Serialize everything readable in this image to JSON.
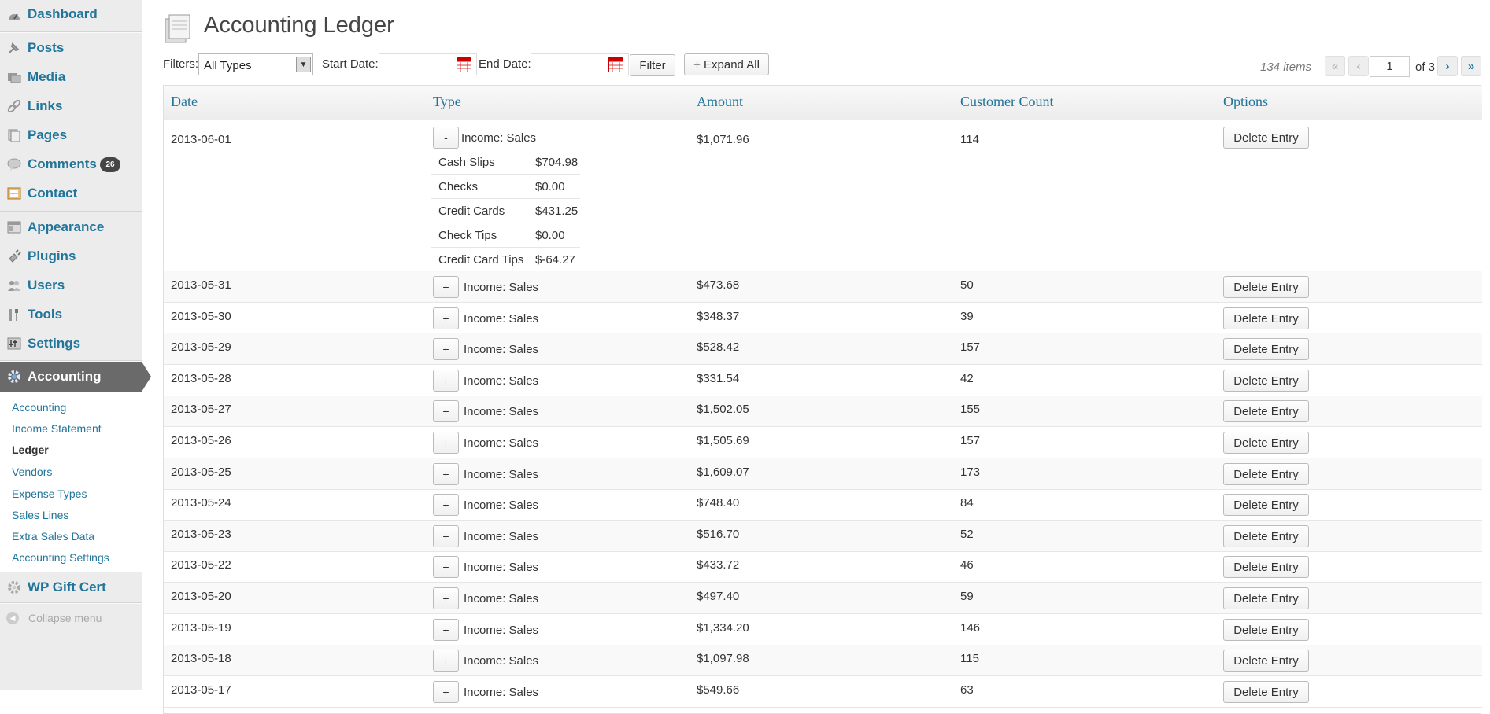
{
  "sidebar": {
    "items": [
      {
        "label": "Dashboard",
        "icon": "dashboard-icon"
      },
      {
        "label": "Posts",
        "icon": "pin-icon"
      },
      {
        "label": "Media",
        "icon": "media-icon"
      },
      {
        "label": "Links",
        "icon": "links-icon"
      },
      {
        "label": "Pages",
        "icon": "pages-icon"
      },
      {
        "label": "Comments",
        "icon": "comments-icon",
        "badge": "26"
      },
      {
        "label": "Contact",
        "icon": "contact-icon"
      },
      {
        "label": "Appearance",
        "icon": "appearance-icon"
      },
      {
        "label": "Plugins",
        "icon": "plugins-icon"
      },
      {
        "label": "Users",
        "icon": "users-icon"
      },
      {
        "label": "Tools",
        "icon": "tools-icon"
      },
      {
        "label": "Settings",
        "icon": "settings-icon"
      }
    ],
    "active": {
      "label": "Accounting",
      "icon": "gear-icon"
    },
    "submenu": [
      "Accounting",
      "Income Statement",
      "Ledger",
      "Vendors",
      "Expense Types",
      "Sales Lines",
      "Extra Sales Data",
      "Accounting Settings"
    ],
    "current_sub": "Ledger",
    "after": {
      "label": "WP Gift Cert",
      "icon": "gear-icon"
    },
    "collapse": "Collapse menu"
  },
  "page": {
    "title": "Accounting Ledger"
  },
  "filters": {
    "label": "Filters:",
    "type_value": "All Types",
    "start_label": "Start Date:",
    "end_label": "End Date:",
    "filter_button": "Filter",
    "expand_button": "+ Expand All"
  },
  "pagination": {
    "items": "134 items",
    "first": "«",
    "prev": "‹",
    "next": "›",
    "last": "»",
    "current": "1",
    "of": "of 3"
  },
  "table": {
    "columns": [
      "Date",
      "Type",
      "Amount",
      "Customer Count",
      "Options"
    ],
    "delete_label": "Delete Entry",
    "expanded_row": {
      "date": "2013-06-01",
      "toggle": "-",
      "type": "Income: Sales",
      "amount": "$1,071.96",
      "count": "114",
      "details": [
        {
          "k": "Cash Slips",
          "v": "$704.98"
        },
        {
          "k": "Checks",
          "v": "$0.00"
        },
        {
          "k": "Credit Cards",
          "v": "$431.25"
        },
        {
          "k": "Check Tips",
          "v": "$0.00"
        },
        {
          "k": "Credit Card Tips",
          "v": "$-64.27"
        }
      ]
    },
    "rows": [
      {
        "date": "2013-05-31",
        "toggle": "+",
        "type": "Income: Sales",
        "amount": "$473.68",
        "count": "50"
      },
      {
        "date": "2013-05-30",
        "toggle": "+",
        "type": "Income: Sales",
        "amount": "$348.37",
        "count": "39"
      },
      {
        "date": "2013-05-29",
        "toggle": "+",
        "type": "Income: Sales",
        "amount": "$528.42",
        "count": "157"
      },
      {
        "date": "2013-05-28",
        "toggle": "+",
        "type": "Income: Sales",
        "amount": "$331.54",
        "count": "42"
      },
      {
        "date": "2013-05-27",
        "toggle": "+",
        "type": "Income: Sales",
        "amount": "$1,502.05",
        "count": "155"
      },
      {
        "date": "2013-05-26",
        "toggle": "+",
        "type": "Income: Sales",
        "amount": "$1,505.69",
        "count": "157"
      },
      {
        "date": "2013-05-25",
        "toggle": "+",
        "type": "Income: Sales",
        "amount": "$1,609.07",
        "count": "173"
      },
      {
        "date": "2013-05-24",
        "toggle": "+",
        "type": "Income: Sales",
        "amount": "$748.40",
        "count": "84"
      },
      {
        "date": "2013-05-23",
        "toggle": "+",
        "type": "Income: Sales",
        "amount": "$516.70",
        "count": "52"
      },
      {
        "date": "2013-05-22",
        "toggle": "+",
        "type": "Income: Sales",
        "amount": "$433.72",
        "count": "46"
      },
      {
        "date": "2013-05-20",
        "toggle": "+",
        "type": "Income: Sales",
        "amount": "$497.40",
        "count": "59"
      },
      {
        "date": "2013-05-19",
        "toggle": "+",
        "type": "Income: Sales",
        "amount": "$1,334.20",
        "count": "146"
      },
      {
        "date": "2013-05-18",
        "toggle": "+",
        "type": "Income: Sales",
        "amount": "$1,097.98",
        "count": "115"
      },
      {
        "date": "2013-05-17",
        "toggle": "+",
        "type": "Income: Sales",
        "amount": "$549.66",
        "count": "63"
      }
    ]
  }
}
